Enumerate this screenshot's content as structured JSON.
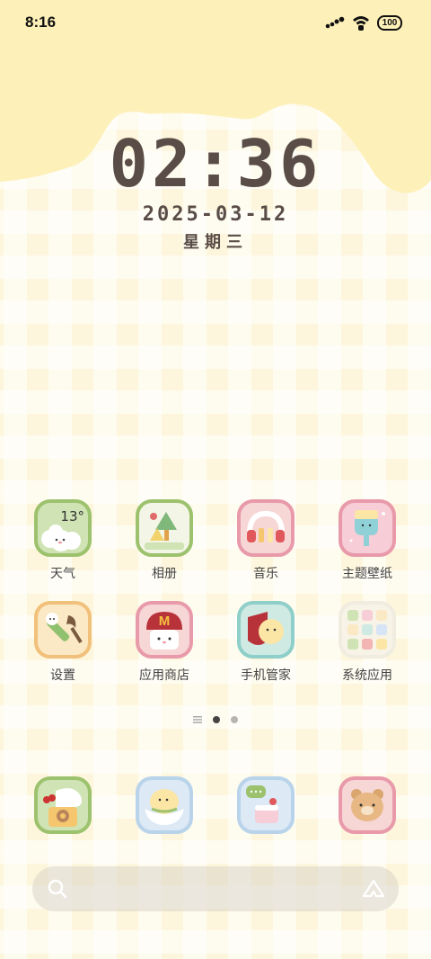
{
  "status_bar": {
    "time": "8:16",
    "battery": "100"
  },
  "lockclock": {
    "time": "02:36",
    "date": "2025-03-12",
    "weekday": "星期三"
  },
  "apps": {
    "weather": {
      "label": "天气",
      "temp": "13°"
    },
    "gallery": {
      "label": "相册"
    },
    "music": {
      "label": "音乐"
    },
    "themes": {
      "label": "主题壁纸"
    },
    "settings": {
      "label": "设置"
    },
    "app_store": {
      "label": "应用商店",
      "logo": "M"
    },
    "phone_manager": {
      "label": "手机管家"
    },
    "system_apps": {
      "label": "系统应用"
    }
  },
  "page_indicator": {
    "pages": 2,
    "current": 1
  },
  "colors": {
    "background": "#fdf6dc",
    "hill": "#fdf0b8",
    "text_dark": "#5a4d47"
  }
}
